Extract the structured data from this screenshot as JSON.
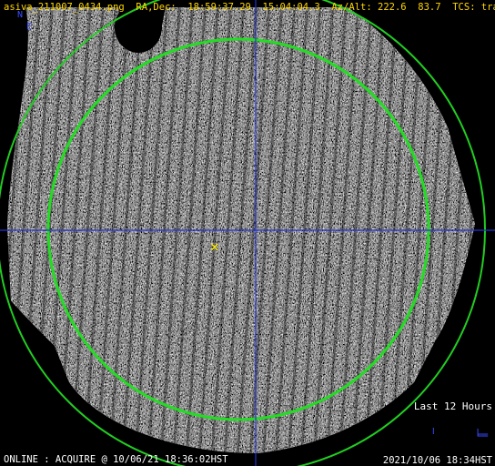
{
  "header": {
    "filename": "asiva_211007_0434.png",
    "radec_label": "RA,Dec:",
    "ra": "18:59:37.29",
    "dec": "15:04:04.3",
    "azalt_label": "Az/Alt:",
    "az": "222.6",
    "alt": "83.7",
    "tcs_label": "TCS:",
    "tcs_state": "track"
  },
  "compass": {
    "north": "N",
    "east": "E"
  },
  "legend": {
    "window": "Last 12 Hours",
    "trail_glyph": "╷",
    "scale_glyph": "╘═"
  },
  "status": {
    "left": "ONLINE : ACQUIRE @ 10/06/21 18:36:02HST",
    "right": "2021/10/06 18:34HST"
  },
  "overlay": {
    "target_marker": "✕",
    "colors": {
      "header_text": "#ffd700",
      "outer_circle": "#22cc22",
      "inner_circle": "#22dd22",
      "crosshair": "#2233cc",
      "target": "#ffee00",
      "compass": "#3a4dff",
      "status_text": "#ffffff"
    }
  }
}
